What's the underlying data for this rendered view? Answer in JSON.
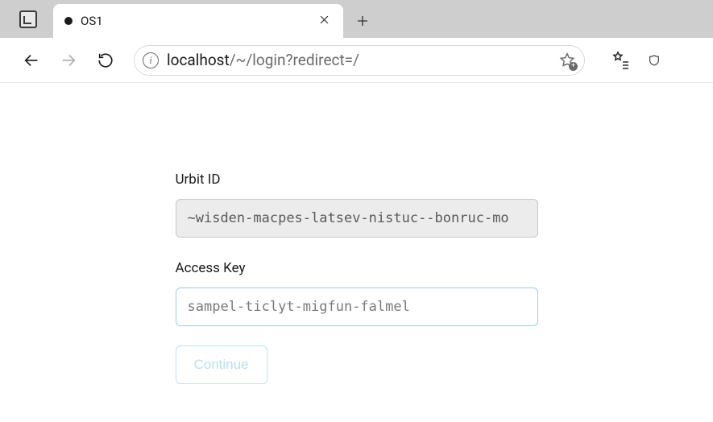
{
  "browser": {
    "tab": {
      "title": "OS1"
    },
    "url": {
      "host": "localhost",
      "path": "/~/login?redirect=/"
    }
  },
  "login": {
    "urbit_id_label": "Urbit ID",
    "urbit_id_value": "~wisden-macpes-latsev-nistuc--bonruc-mo",
    "access_key_label": "Access Key",
    "access_key_placeholder": "sampel-ticlyt-migfun-falmel",
    "access_key_value": "",
    "continue_label": "Continue"
  },
  "icons": {
    "info_glyph": "i",
    "plus_badge": "+"
  }
}
